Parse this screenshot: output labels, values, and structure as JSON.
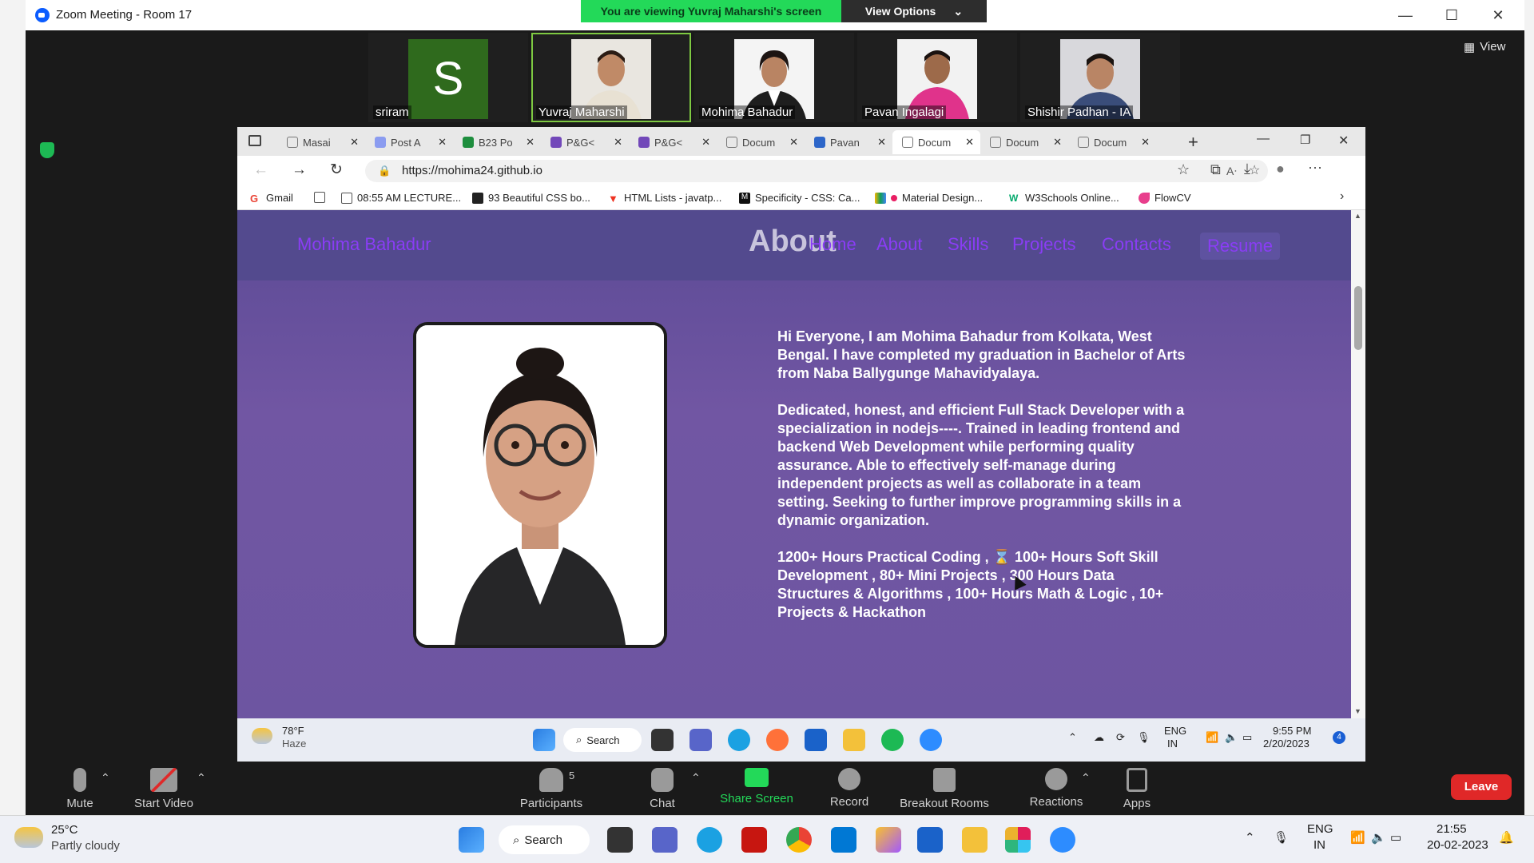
{
  "zoom": {
    "title": "Zoom Meeting - Room 17",
    "share_banner": "You are viewing Yuvraj Maharshi's screen",
    "view_options": "View Options",
    "view": "View",
    "participants": [
      {
        "name": "sriram",
        "initial": "S"
      },
      {
        "name": "Yuvraj Maharshi"
      },
      {
        "name": "Mohima Bahadur"
      },
      {
        "name": "Pavan Ingalagi"
      },
      {
        "name": "Shishir Padhan - IA"
      }
    ],
    "controls": {
      "mute": "Mute",
      "start_video": "Start Video",
      "participants": "Participants",
      "participants_count": "5",
      "chat": "Chat",
      "share_screen": "Share Screen",
      "record": "Record",
      "breakout_rooms": "Breakout Rooms",
      "reactions": "Reactions",
      "apps": "Apps",
      "leave": "Leave"
    }
  },
  "browser": {
    "tabs": [
      "Masai",
      "Post A",
      "B23 Po",
      "P&G<",
      "P&G<",
      "Docum",
      "Pavan",
      "Docum",
      "Docum",
      "Docum"
    ],
    "url": "https://mohima24.github.io",
    "bookmarks": [
      "Gmail",
      "08:55 AM LECTURE...",
      "93 Beautiful CSS bo...",
      "HTML Lists - javatp...",
      "Specificity - CSS: Ca...",
      "Material Design...",
      "W3Schools Online...",
      "FlowCV"
    ]
  },
  "webpage": {
    "brand": "Mohima Bahadur",
    "section_heading": "About",
    "nav": [
      "Home",
      "About",
      "Skills",
      "Projects",
      "Contacts"
    ],
    "resume": "Resume",
    "paragraphs": [
      "Hi Everyone, I am Mohima Bahadur from Kolkata, West Bengal. I have completed my graduation in Bachelor of Arts from Naba Ballygunge Mahavidyalaya.",
      "Dedicated, honest, and efficient Full Stack Developer with a specialization in nodejs----. Trained in leading frontend and backend Web Development while performing quality assurance. Able to effectively self-manage during independent projects as well as collaborate in a team setting. Seeking to further improve programming skills in a dynamic organization.",
      "1200+ Hours Practical Coding , ⌛ 100+ Hours Soft Skill Development , 80+ Mini Projects , 300 Hours Data Structures & Algorithms , 100+ Hours Math & Logic , 10+ Projects & Hackathon"
    ]
  },
  "remote_taskbar": {
    "weather_temp": "78°F",
    "weather_desc": "Haze",
    "search": "Search",
    "lang_top": "ENG",
    "lang_bottom": "IN",
    "time": "9:55 PM",
    "date": "2/20/2023",
    "notif_count": "4"
  },
  "host_taskbar": {
    "weather_temp": "25°C",
    "weather_desc": "Partly cloudy",
    "search": "Search",
    "lang_top": "ENG",
    "lang_bottom": "IN",
    "time": "21:55",
    "date": "20-02-2023"
  },
  "colors": {
    "zoom_green": "#23d959",
    "site_accent": "#8a3df5",
    "leave_red": "#e02828"
  }
}
